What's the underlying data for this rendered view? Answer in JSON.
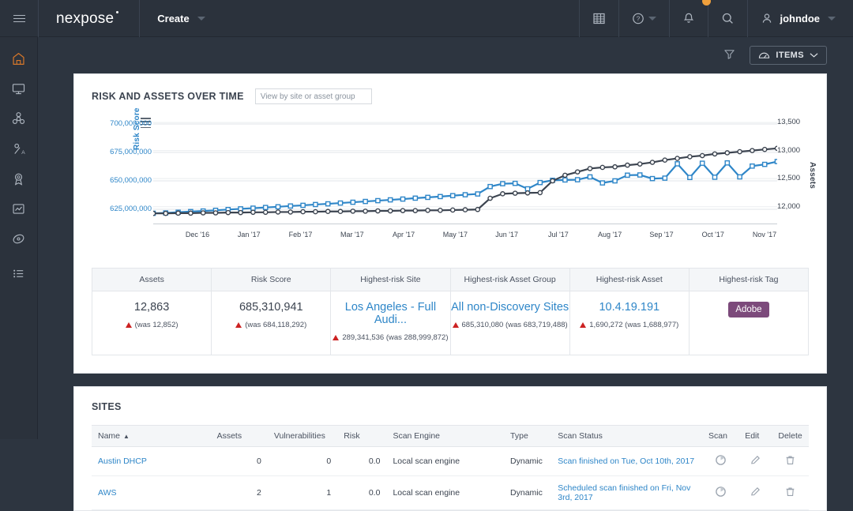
{
  "topbar": {
    "menu_icon": "hamburger-icon",
    "logo": "nexpose",
    "create_label": "Create",
    "grid_icon": "grid-icon",
    "help_icon": "help-icon",
    "bell_icon": "bell-icon",
    "search_icon": "search-icon",
    "user_icon": "user-icon",
    "username": "johndoe"
  },
  "rail": {
    "items": [
      {
        "name": "home-icon",
        "label": "Home",
        "active": true
      },
      {
        "name": "assets-icon",
        "label": "Assets",
        "active": false
      },
      {
        "name": "vulnerabilities-icon",
        "label": "Vulnerabilities",
        "active": false
      },
      {
        "name": "policies-icon",
        "label": "Policies",
        "active": false
      },
      {
        "name": "exceptions-icon",
        "label": "Exceptions",
        "active": false
      },
      {
        "name": "reports-icon",
        "label": "Reports",
        "active": false
      },
      {
        "name": "tickets-icon",
        "label": "Tickets",
        "active": false
      },
      {
        "name": "administration-icon",
        "label": "Administration",
        "active": false
      }
    ]
  },
  "filterbar": {
    "filter_icon": "funnel-icon",
    "items_label": "ITEMS",
    "items_icon": "cloud-icon",
    "items_caret": "chevron-down-icon"
  },
  "chart_card": {
    "title": "RISK AND ASSETS OVER TIME",
    "search_placeholder": "View by site or asset group",
    "search_value": "",
    "search_icon": "search-icon",
    "menu_icon": "chart-menu-icon"
  },
  "chart_data": {
    "type": "line",
    "title": "RISK AND ASSETS OVER TIME",
    "xlabel": "",
    "grid": true,
    "legend": false,
    "x_tick_labels": [
      "Dec '16",
      "Jan '17",
      "Feb '17",
      "Mar '17",
      "Apr '17",
      "May '17",
      "Jun '17",
      "Jul '17",
      "Aug '17",
      "Sep '17",
      "Oct '17",
      "Nov '17"
    ],
    "left_axis": {
      "label": "Risk Score",
      "color": "#2e86c8",
      "ticks": [
        "625,000,000",
        "650,000,000",
        "675,000,000",
        "700,000,000"
      ],
      "ylim": [
        612500000,
        706250000
      ]
    },
    "right_axis": {
      "label": "Assets",
      "color": "#3c4450",
      "ticks": [
        "12,000",
        "12,500",
        "13,000",
        "13,500"
      ],
      "ylim": [
        11700,
        13600
      ]
    },
    "series": [
      {
        "name": "Risk Score",
        "axis": "left",
        "color": "#2e86c8",
        "values": [
          621500000,
          621800000,
          622400000,
          623000000,
          623500000,
          624100000,
          624800000,
          625400000,
          626000000,
          626600000,
          627200000,
          627900000,
          628500000,
          629200000,
          629800000,
          630500000,
          631200000,
          631900000,
          632600000,
          633300000,
          634000000,
          634800000,
          635500000,
          636200000,
          637000000,
          637800000,
          638500000,
          645000000,
          647500000,
          647800000,
          643000000,
          648500000,
          650500000,
          650800000,
          651000000,
          653500000,
          648200000,
          650000000,
          655000000,
          655200000,
          652000000,
          652400000,
          665000000,
          653000000,
          665500000,
          653200000,
          665800000,
          653500000,
          663000000,
          664500000,
          667000000
        ]
      },
      {
        "name": "Assets",
        "axis": "right",
        "color": "#3c4450",
        "values": [
          11880,
          11880,
          11885,
          11885,
          11890,
          11890,
          11895,
          11895,
          11900,
          11900,
          11905,
          11905,
          11910,
          11910,
          11915,
          11915,
          11920,
          11920,
          11925,
          11925,
          11930,
          11930,
          11935,
          11935,
          11940,
          11945,
          11950,
          12150,
          12230,
          12240,
          12245,
          12250,
          12460,
          12560,
          12620,
          12680,
          12700,
          12710,
          12740,
          12760,
          12790,
          12830,
          12860,
          12890,
          12910,
          12940,
          12960,
          12980,
          13000,
          13020,
          13040
        ]
      }
    ]
  },
  "summary": {
    "columns": [
      {
        "header": "Assets",
        "value": "12,863",
        "is_link": false,
        "delta_prefix": "",
        "was": "(was 12,852)"
      },
      {
        "header": "Risk Score",
        "value": "685,310,941",
        "is_link": false,
        "delta_prefix": "",
        "was": "(was 684,118,292)"
      },
      {
        "header": "Highest-risk Site",
        "value": "Los Angeles - Full Audi...",
        "is_link": true,
        "delta_prefix": "289,341,536",
        "was": "(was 288,999,872)"
      },
      {
        "header": "Highest-risk Asset Group",
        "value": "All non-Discovery Sites",
        "is_link": true,
        "delta_prefix": "685,310,080",
        "was": "(was 683,719,488)"
      },
      {
        "header": "Highest-risk Asset",
        "value": "10.4.19.191",
        "is_link": true,
        "delta_prefix": "1,690,272",
        "was": "(was 1,688,977)"
      },
      {
        "header": "Highest-risk Tag",
        "tag": "Adobe",
        "tag_color": "#7c4a7b"
      }
    ]
  },
  "sites": {
    "title": "SITES",
    "columns": [
      "Name",
      "Assets",
      "Vulnerabilities",
      "Risk",
      "Scan Engine",
      "Type",
      "Scan Status",
      "Scan",
      "Edit",
      "Delete"
    ],
    "sort_column": "Name",
    "sort_direction": "asc",
    "rows": [
      {
        "name": "Austin DHCP",
        "assets": "0",
        "vulnerabilities": "0",
        "risk": "0.0",
        "scan_engine": "Local scan engine",
        "type": "Dynamic",
        "scan_status": "Scan finished on Tue, Oct 10th, 2017",
        "scan_icon": "scan-icon",
        "edit_icon": "pencil-icon",
        "delete_icon": "trash-icon"
      },
      {
        "name": "AWS",
        "assets": "2",
        "vulnerabilities": "1",
        "risk": "0.0",
        "scan_engine": "Local scan engine",
        "type": "Dynamic",
        "scan_status": "Scheduled scan finished on Fri, Nov 3rd, 2017",
        "scan_icon": "scan-icon",
        "edit_icon": "pencil-icon",
        "delete_icon": "trash-icon"
      }
    ]
  }
}
